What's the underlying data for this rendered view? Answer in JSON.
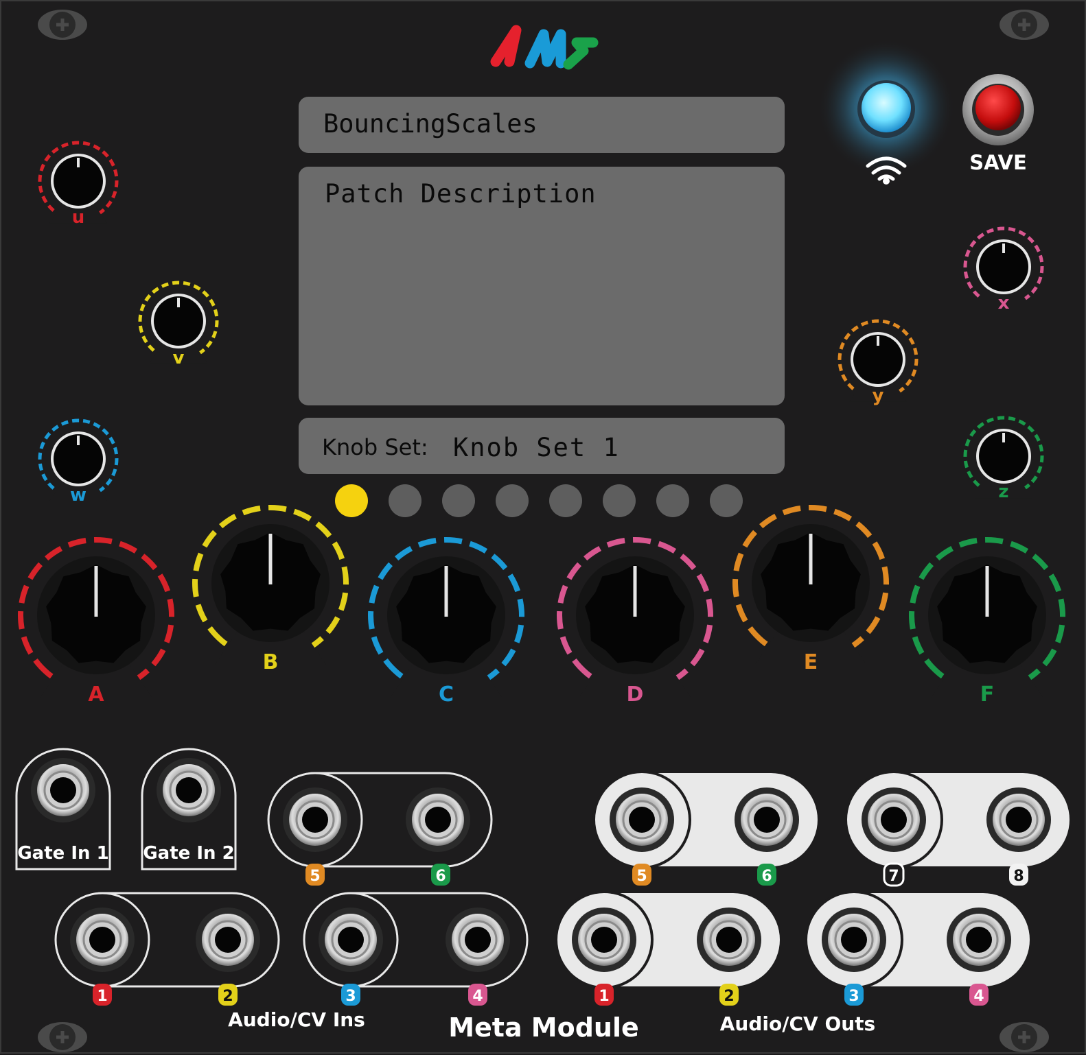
{
  "brand": {
    "logo_text": "4ms",
    "colors": [
      "#e5212d",
      "#1a9bd7",
      "#1aa24a"
    ]
  },
  "screen": {
    "patch_name": "BouncingScales",
    "description_label": "Patch Description",
    "knobset_label": "Knob Set:",
    "knobset_value": "Knob Set 1"
  },
  "buttons": {
    "save_label": "SAVE",
    "wifi_icon": "wifi-icon"
  },
  "knobset_dots": {
    "count": 8,
    "active_index": 0,
    "active_color": "#f5d20f"
  },
  "small_knobs": [
    {
      "label": "u",
      "color": "#d8232a"
    },
    {
      "label": "v",
      "color": "#e3d11a"
    },
    {
      "label": "w",
      "color": "#1b9ad6"
    },
    {
      "label": "x",
      "color": "#d95790"
    },
    {
      "label": "y",
      "color": "#e08a23"
    },
    {
      "label": "z",
      "color": "#1a9a4a"
    }
  ],
  "big_knobs": [
    {
      "label": "A",
      "color": "#d8232a"
    },
    {
      "label": "B",
      "color": "#e3d11a"
    },
    {
      "label": "C",
      "color": "#1b9ad6"
    },
    {
      "label": "D",
      "color": "#d95790"
    },
    {
      "label": "E",
      "color": "#e08a23"
    },
    {
      "label": "F",
      "color": "#1a9a4a"
    }
  ],
  "jacks": {
    "gate_in_1": "Gate In 1",
    "gate_in_2": "Gate In 2",
    "ins_label": "Audio/CV Ins",
    "outs_label": "Audio/CV Outs",
    "module_name": "Meta Module",
    "in_tags": [
      {
        "n": "1",
        "color": "#d8232a"
      },
      {
        "n": "2",
        "color": "#e3d11a"
      },
      {
        "n": "3",
        "color": "#1b9ad6"
      },
      {
        "n": "4",
        "color": "#d95790"
      },
      {
        "n": "5",
        "color": "#e08a23"
      },
      {
        "n": "6",
        "color": "#1a9a4a"
      }
    ],
    "out_tags": [
      {
        "n": "1",
        "color": "#d8232a"
      },
      {
        "n": "2",
        "color": "#e3d11a"
      },
      {
        "n": "3",
        "color": "#1b9ad6"
      },
      {
        "n": "4",
        "color": "#d95790"
      },
      {
        "n": "5",
        "color": "#e08a23"
      },
      {
        "n": "6",
        "color": "#1a9a4a"
      },
      {
        "n": "7",
        "color": "#1d1c1d"
      },
      {
        "n": "8",
        "color": "#f2f2f2"
      }
    ]
  }
}
